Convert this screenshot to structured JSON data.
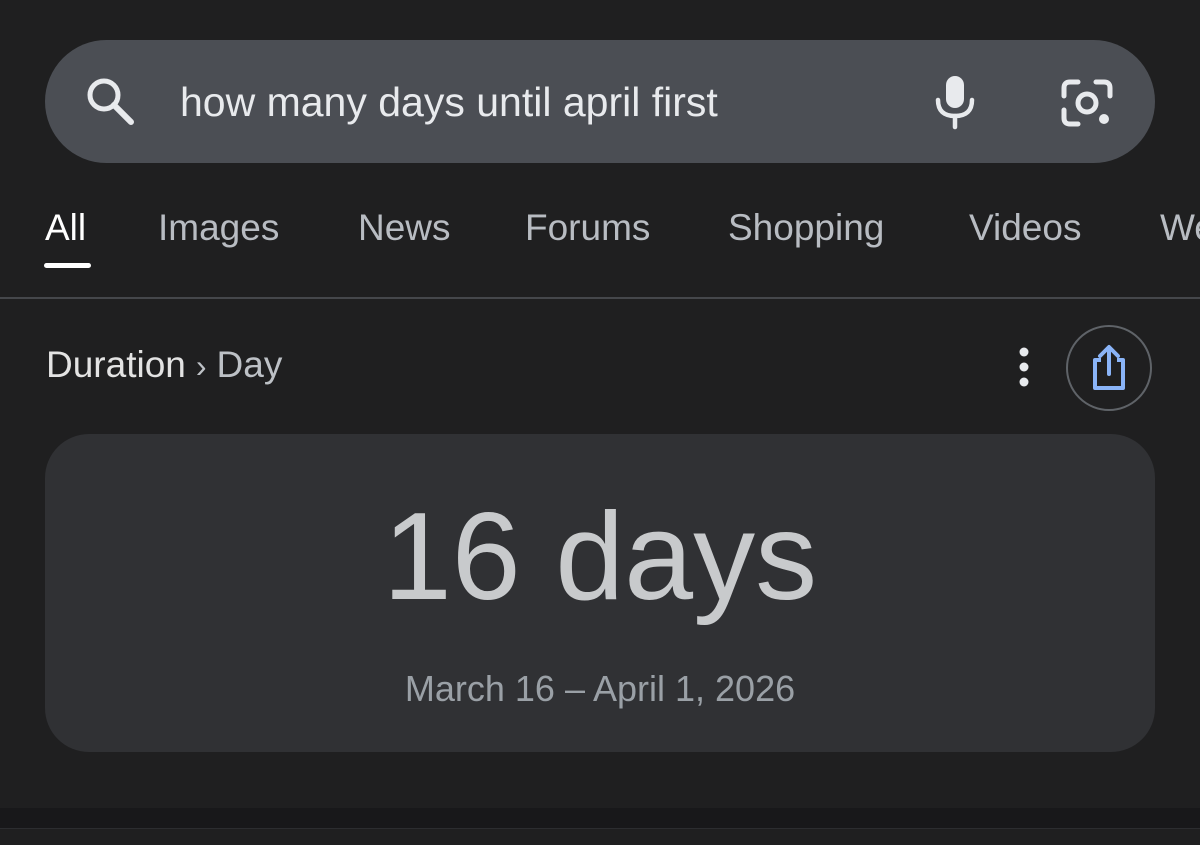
{
  "search": {
    "query": "how many days until april first"
  },
  "tabs": [
    {
      "label": "All"
    },
    {
      "label": "Images"
    },
    {
      "label": "News"
    },
    {
      "label": "Forums"
    },
    {
      "label": "Shopping"
    },
    {
      "label": "Videos"
    },
    {
      "label": "We"
    }
  ],
  "breadcrumb": {
    "main": "Duration",
    "separator": "›",
    "sub": "Day"
  },
  "result": {
    "value": "16 days",
    "range": "March 16 – April 1, 2026"
  },
  "colors": {
    "background": "#1f1f20",
    "search_bar": "#4b4e54",
    "card": "#303134",
    "accent_share": "#8ab4f8"
  },
  "icons": {
    "search": "search-icon",
    "voice": "mic-icon",
    "lens": "lens-icon",
    "more": "more-vert-icon",
    "share": "share-icon"
  }
}
